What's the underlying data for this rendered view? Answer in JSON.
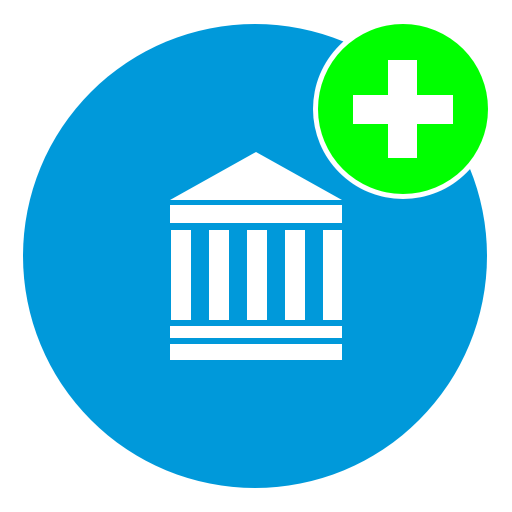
{
  "app_icon": {
    "icon": "bank-building-icon",
    "badge_icon": "plus-icon",
    "colors": {
      "circle": "#0099DA",
      "badge": "#00FF00",
      "glyph": "#FFFFFF",
      "outline": "#FFFFFF"
    }
  }
}
